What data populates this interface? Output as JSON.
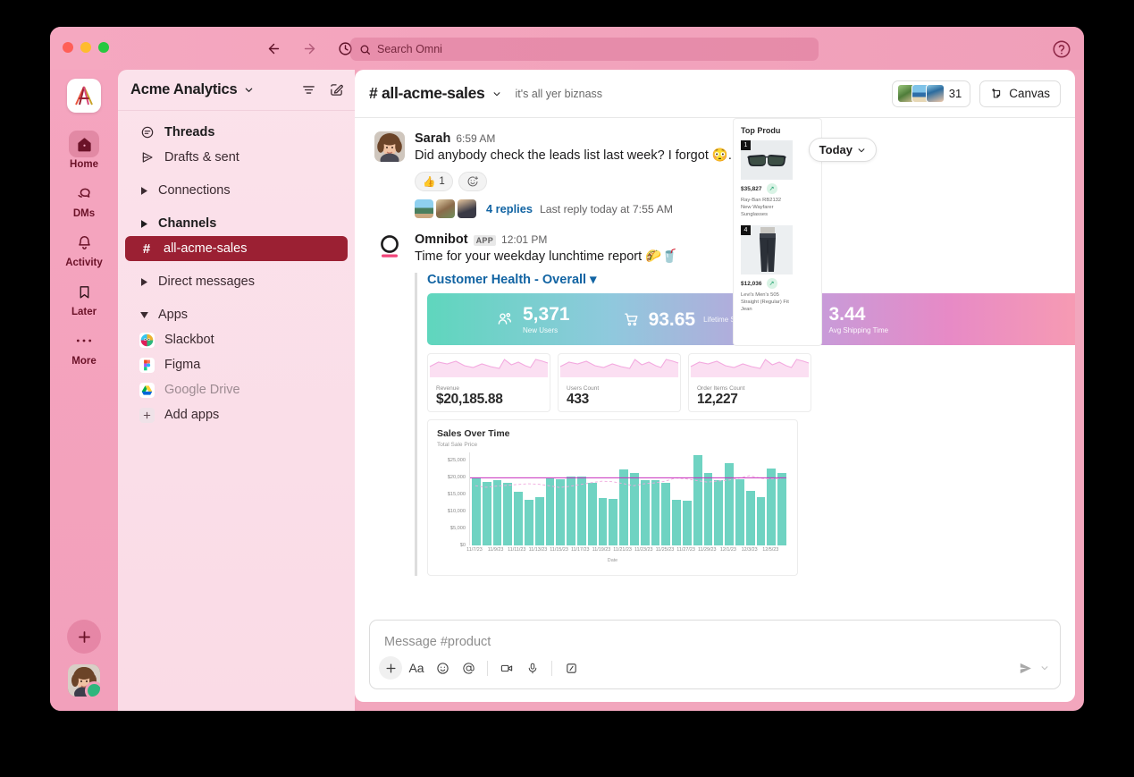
{
  "window": {
    "traffic_lights": [
      "close",
      "minimize",
      "maximize"
    ],
    "search_placeholder": "Search Omni",
    "help_label": "help"
  },
  "rail": {
    "workspace_logo": "acme-analytics-logo",
    "items": [
      {
        "label": "Home",
        "icon": "home-icon",
        "active": true
      },
      {
        "label": "DMs",
        "icon": "dm-icon",
        "active": false
      },
      {
        "label": "Activity",
        "icon": "bell-icon",
        "active": false
      },
      {
        "label": "Later",
        "icon": "bookmark-icon",
        "active": false
      },
      {
        "label": "More",
        "icon": "ellipsis-icon",
        "active": false
      }
    ],
    "new_button": "+",
    "avatar": "user-avatar"
  },
  "sidebar": {
    "workspace": "Acme Analytics",
    "filter_icon": "filter-icon",
    "compose_icon": "compose-icon",
    "items": [
      {
        "label": "Threads",
        "icon": "threads-icon",
        "style": "bold"
      },
      {
        "label": "Drafts & sent",
        "icon": "drafts-icon",
        "style": "normal"
      },
      {
        "label": "Connections",
        "icon": "caret-right-icon",
        "style": "normal",
        "gap_before": true
      },
      {
        "label": "Channels",
        "icon": "caret-right-icon",
        "style": "bold",
        "gap_before": true
      },
      {
        "label": "all-acme-sales",
        "icon": "hash-icon",
        "style": "active"
      },
      {
        "label": "Direct messages",
        "icon": "caret-right-icon",
        "style": "normal",
        "gap_before": true
      },
      {
        "label": "Apps",
        "icon": "caret-down-icon",
        "style": "normal",
        "gap_before": true
      },
      {
        "label": "Slackbot",
        "icon": "slackbot-icon",
        "style": "normal"
      },
      {
        "label": "Figma",
        "icon": "figma-icon",
        "style": "normal"
      },
      {
        "label": "Google Drive",
        "icon": "google-drive-icon",
        "style": "muted"
      },
      {
        "label": "Add apps",
        "icon": "plus-box-icon",
        "style": "normal"
      }
    ]
  },
  "channel": {
    "name": "# all-acme-sales",
    "topic": "it's all yer biznass",
    "member_count": "31",
    "canvas_label": "Canvas",
    "date_divider": "Today"
  },
  "messages": [
    {
      "author": "Sarah",
      "time": "6:59 AM",
      "is_app": false,
      "text": "Did anybody check the leads list last week? I forgot 😳...",
      "reaction_emoji": "👍",
      "reaction_count": "1",
      "add_reaction": "add-reaction",
      "thread_replies": "4 replies",
      "thread_last": "Last reply today at 7:55 AM"
    },
    {
      "author": "Omnibot",
      "app_badge": "APP",
      "time": "12:01 PM",
      "is_app": true,
      "text": "Time for your weekday lunchtime report 🌮🥤"
    }
  ],
  "unfurl": {
    "title": "Customer Health - Overall",
    "banner": [
      {
        "icon": "users-icon",
        "value": "5,371",
        "caption": "New Users"
      },
      {
        "icon": "cart-icon",
        "value": "93.65",
        "caption": "Lifetime Spend"
      },
      {
        "icon": "clock-icon",
        "value": "3.44",
        "caption": "Avg Shipping Time"
      }
    ],
    "cards": [
      {
        "caption": "Revenue",
        "value": "$20,185.88"
      },
      {
        "caption": "Users Count",
        "value": "433"
      },
      {
        "caption": "Order Items Count",
        "value": "12,227"
      }
    ],
    "top_products": {
      "title": "Top Produ",
      "items": [
        {
          "rank": "1",
          "value": "$35,827",
          "trend": "↗",
          "name": "Ray-Ban RB2132 New Wayfarer Sunglasses",
          "image": "sunglasses"
        },
        {
          "rank": "4",
          "value": "$12,036",
          "trend": "↗",
          "name": "Levi's Men's 505 Straight (Regular) Fit Jean",
          "image": "jeans"
        }
      ]
    }
  },
  "chart_data": {
    "type": "bar",
    "title": "Sales Over Time",
    "subtitle": "Total Sale Price",
    "xlabel": "Date",
    "ylabel": "Total Sale Price",
    "ylim": [
      0,
      27500
    ],
    "ytick_labels": [
      "$25,000",
      "$20,000",
      "$15,000",
      "$10,000",
      "$5,000",
      "$0"
    ],
    "ytick_values": [
      25000,
      20000,
      15000,
      10000,
      5000,
      0
    ],
    "xtick_labels": [
      "11/7/23",
      "11/9/23",
      "11/11/23",
      "11/13/23",
      "11/15/23",
      "11/17/23",
      "11/19/23",
      "11/21/23",
      "11/23/23",
      "11/25/23",
      "11/27/23",
      "11/29/23",
      "12/1/23",
      "12/3/23",
      "12/5/23"
    ],
    "bar_color": "#6fd3c2",
    "reference_line": {
      "value": 20000,
      "color": "#c72dbd",
      "style": "solid"
    },
    "trend_line": {
      "color": "#f0a8dd",
      "style": "dashed"
    },
    "grid": false,
    "legend": "none",
    "values": [
      20050,
      18900,
      19350,
      18400,
      15800,
      13500,
      14350,
      19950,
      19650,
      20250,
      20400,
      18450,
      14050,
      13700,
      22450,
      21450,
      19350,
      19300,
      18400,
      13450,
      13150,
      26750,
      21450,
      19350,
      24350,
      19450,
      16100,
      14300,
      22750,
      21300
    ]
  },
  "composer": {
    "placeholder": "Message #product",
    "tools": [
      "plus-icon",
      "format-icon",
      "emoji-icon",
      "mention-icon",
      "video-icon",
      "mic-icon",
      "slash-icon"
    ],
    "send_icon": "send-icon",
    "send_options_icon": "chevron-down-icon"
  }
}
